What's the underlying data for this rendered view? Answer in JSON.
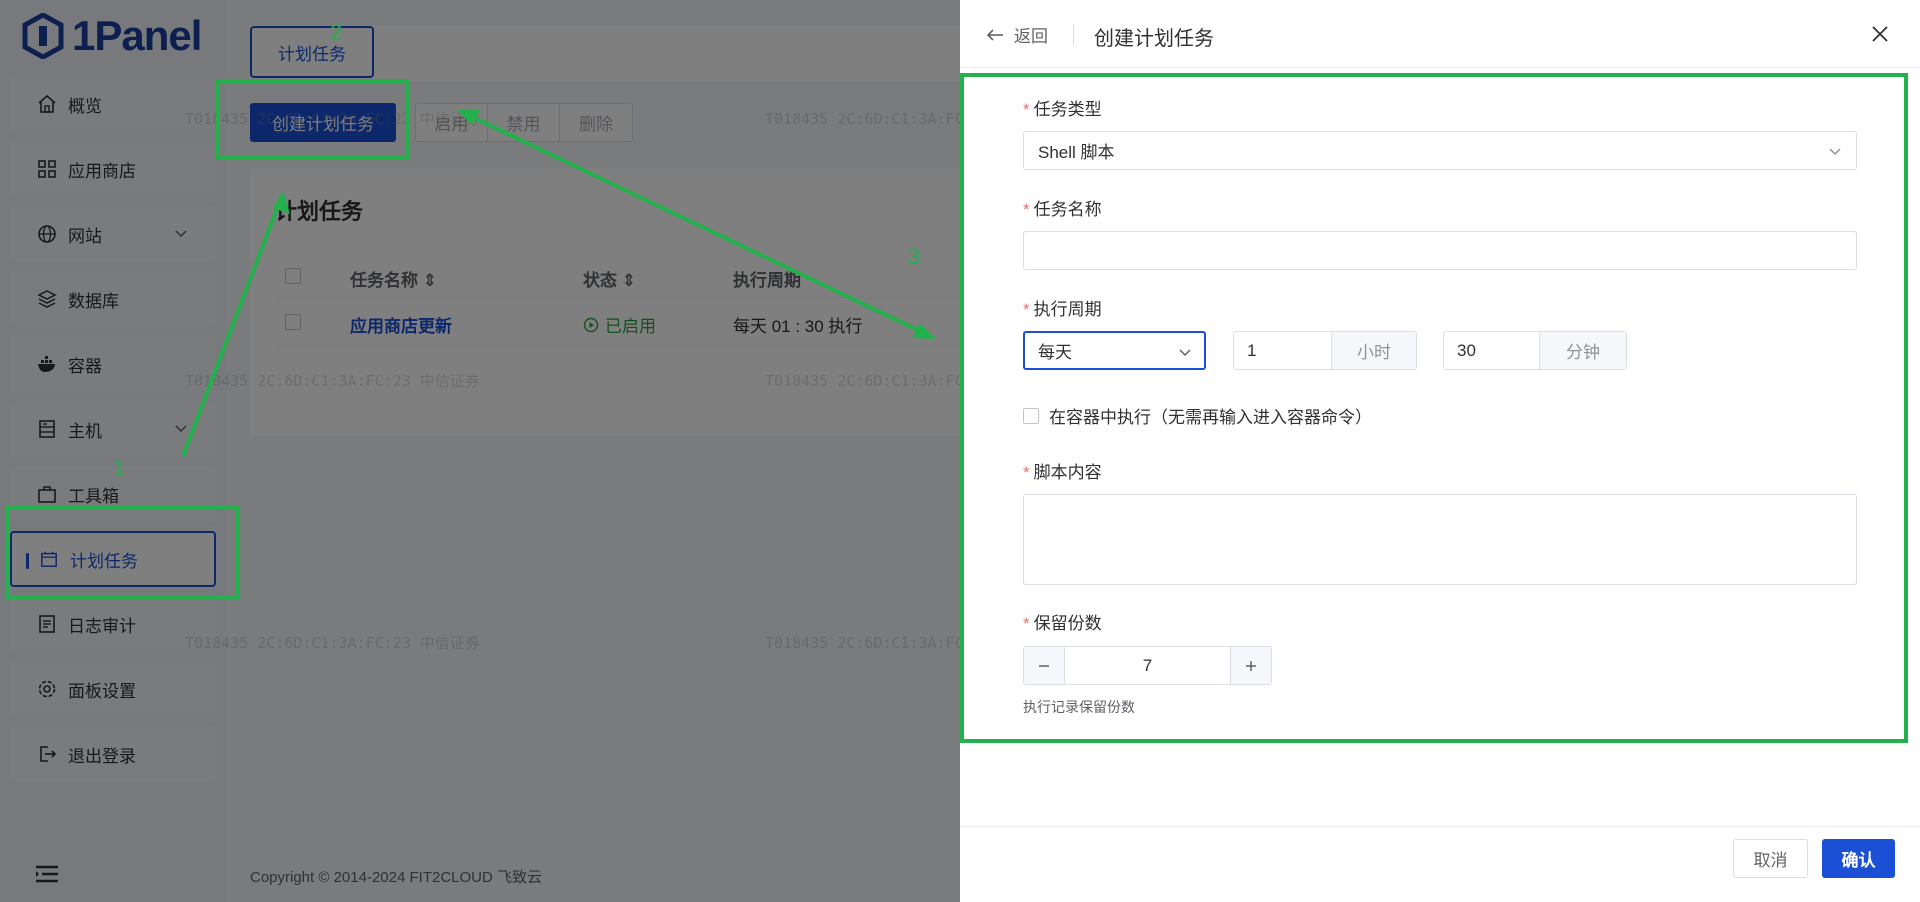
{
  "app": {
    "logo_text": "1Panel"
  },
  "sidebar": {
    "items": [
      {
        "label": "概览",
        "icon": "home-icon"
      },
      {
        "label": "应用商店",
        "icon": "grid-icon"
      },
      {
        "label": "网站",
        "icon": "globe-icon",
        "has_children": true
      },
      {
        "label": "数据库",
        "icon": "layers-icon"
      },
      {
        "label": "容器",
        "icon": "docker-icon"
      },
      {
        "label": "主机",
        "icon": "server-icon",
        "has_children": true
      },
      {
        "label": "工具箱",
        "icon": "toolbox-icon"
      },
      {
        "label": "计划任务",
        "icon": "calendar-icon",
        "active": true
      },
      {
        "label": "日志审计",
        "icon": "log-icon"
      },
      {
        "label": "面板设置",
        "icon": "gear-icon"
      },
      {
        "label": "退出登录",
        "icon": "logout-icon"
      }
    ]
  },
  "main": {
    "tab_label": "计划任务",
    "create_button": "创建计划任务",
    "actions": [
      "启用",
      "禁用",
      "删除"
    ],
    "card_title": "计划任务",
    "columns": [
      "任务名称",
      "状态",
      "执行周期"
    ],
    "rows": [
      {
        "name": "应用商店更新",
        "status": "已启用",
        "period": "每天 01 : 30 执行"
      }
    ],
    "footer": "Copyright © 2014-2024 FIT2CLOUD 飞致云"
  },
  "watermark": "T018435  2C:6D:C1:3A:FC:23  中信证券",
  "drawer": {
    "back_label": "返回",
    "title": "创建计划任务",
    "task_type_label": "任务类型",
    "task_type_value": "Shell 脚本",
    "task_name_label": "任务名称",
    "task_name_value": "",
    "period_label": "执行周期",
    "period_value": "每天",
    "hour_value": "1",
    "hour_unit": "小时",
    "minute_value": "30",
    "minute_unit": "分钟",
    "container_checkbox_label": "在容器中执行（无需再输入进入容器命令）",
    "script_label": "脚本内容",
    "script_value": "",
    "retain_label": "保留份数",
    "retain_value": "7",
    "retain_help": "执行记录保留份数",
    "cancel_label": "取消",
    "confirm_label": "确认"
  },
  "annotations": {
    "labels": [
      "1",
      "2",
      "3"
    ],
    "color": "#22b14c"
  }
}
